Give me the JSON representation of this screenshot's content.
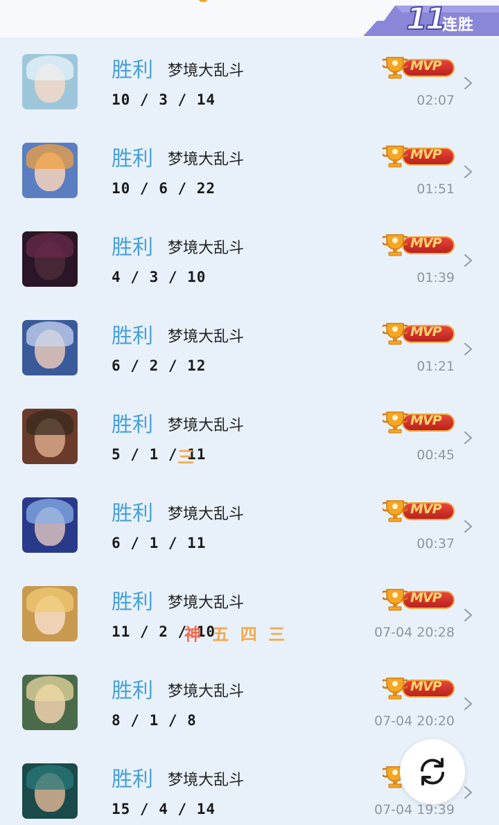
{
  "header": {
    "streak_count": "11",
    "streak_label": "连胜"
  },
  "matches": [
    {
      "result": "胜利",
      "mode": "梦境大乱斗",
      "kda": "10 / 3 / 14",
      "badges": [],
      "mvp": "MVP",
      "time": "02:07",
      "avatar": {
        "bg": "#9ec6da",
        "hair": "#e8f3f8",
        "face": "#f2d8c8"
      }
    },
    {
      "result": "胜利",
      "mode": "梦境大乱斗",
      "kda": "10 / 6 / 22",
      "badges": [],
      "mvp": "MVP",
      "time": "01:51",
      "avatar": {
        "bg": "#5a7ec0",
        "hair": "#f0a040",
        "face": "#f6d2bc"
      }
    },
    {
      "result": "胜利",
      "mode": "梦境大乱斗",
      "kda": "4 / 3 / 10",
      "badges": [],
      "mvp": "MVP",
      "time": "01:39",
      "avatar": {
        "bg": "#2a1626",
        "hair": "#6a2a4a",
        "face": "#4a2a3a"
      }
    },
    {
      "result": "胜利",
      "mode": "梦境大乱斗",
      "kda": "6 / 2 / 12",
      "badges": [],
      "mvp": "MVP",
      "time": "01:21",
      "avatar": {
        "bg": "#3a5a9a",
        "hair": "#c8d6f0",
        "face": "#e8c8b8"
      }
    },
    {
      "result": "胜利",
      "mode": "梦境大乱斗",
      "kda": "5 / 1 / 11",
      "badges": [
        "三"
      ],
      "mvp": "MVP",
      "time": "00:45",
      "avatar": {
        "bg": "#6a3a2a",
        "hair": "#3a2a20",
        "face": "#d8a888"
      }
    },
    {
      "result": "胜利",
      "mode": "梦境大乱斗",
      "kda": "6 / 1 / 11",
      "badges": [],
      "mvp": "MVP",
      "time": "00:37",
      "avatar": {
        "bg": "#2a3a8a",
        "hair": "#8ab0e8",
        "face": "#d8c0c0"
      }
    },
    {
      "result": "胜利",
      "mode": "梦境大乱斗",
      "kda": "11 / 2 / 10",
      "badges": [
        "神",
        "五",
        "四",
        "三"
      ],
      "mvp": "MVP",
      "time": "07-04 20:28",
      "avatar": {
        "bg": "#c89a50",
        "hair": "#f0c870",
        "face": "#f6dcc8"
      }
    },
    {
      "result": "胜利",
      "mode": "梦境大乱斗",
      "kda": "8 / 1 / 8",
      "badges": [],
      "mvp": "MVP",
      "time": "07-04 20:20",
      "avatar": {
        "bg": "#4a6a4a",
        "hair": "#e8d8a0",
        "face": "#f0d0b0"
      }
    },
    {
      "result": "胜利",
      "mode": "梦境大乱斗",
      "kda": "15 / 4 / 14",
      "badges": [],
      "mvp": "MVP",
      "time": "07-04 19:39",
      "avatar": {
        "bg": "#1a4a4a",
        "hair": "#2a7a7a",
        "face": "#d8b090"
      }
    }
  ],
  "fab": {
    "icon": "refresh-icon"
  }
}
